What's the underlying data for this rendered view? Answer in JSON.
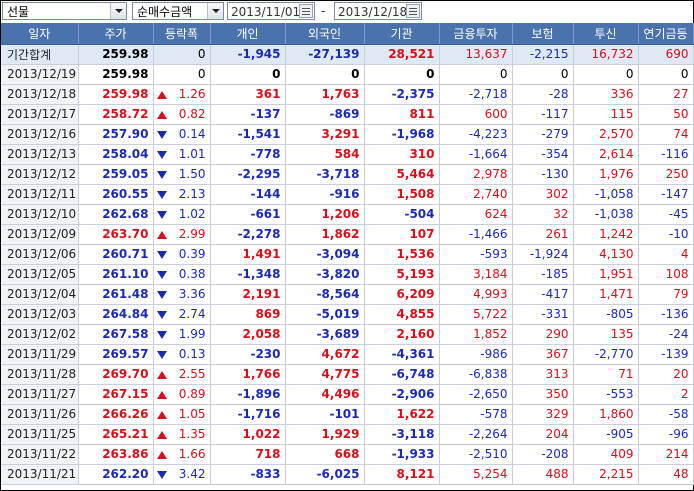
{
  "toolbar": {
    "market": "선물",
    "metric": "순매수금액",
    "date_from": "2013/11/01",
    "date_to": "2013/12/18",
    "separator": "-"
  },
  "colors": {
    "up": "#d4101a",
    "down": "#1a2bb0",
    "header": "#4a73ad"
  },
  "columns": [
    "일자",
    "주가",
    "등락폭",
    "개인",
    "외국인",
    "기관",
    "금융투자",
    "보험",
    "투신",
    "연기금등"
  ],
  "rows": [
    {
      "date": "기간합계",
      "price": "259.98",
      "dir": "",
      "chg": "0",
      "indiv": "-1,945",
      "foreign": "-27,139",
      "inst": "28,521",
      "fin": "13,637",
      "ins": "-2,215",
      "trust": "16,732",
      "pension": "690",
      "sum": true
    },
    {
      "date": "2013/12/19",
      "price": "259.98",
      "dir": "",
      "chg": "0",
      "indiv": "0",
      "foreign": "0",
      "inst": "0",
      "fin": "0",
      "ins": "0",
      "trust": "0",
      "pension": "0"
    },
    {
      "date": "2013/12/18",
      "price": "259.98",
      "dir": "up",
      "chg": "1.26",
      "indiv": "361",
      "foreign": "1,763",
      "inst": "-2,375",
      "fin": "-2,718",
      "ins": "-28",
      "trust": "336",
      "pension": "27"
    },
    {
      "date": "2013/12/17",
      "price": "258.72",
      "dir": "up",
      "chg": "0.82",
      "indiv": "-137",
      "foreign": "-869",
      "inst": "811",
      "fin": "600",
      "ins": "-117",
      "trust": "115",
      "pension": "50"
    },
    {
      "date": "2013/12/16",
      "price": "257.90",
      "dir": "dn",
      "chg": "0.14",
      "indiv": "-1,541",
      "foreign": "3,291",
      "inst": "-1,968",
      "fin": "-4,223",
      "ins": "-279",
      "trust": "2,570",
      "pension": "74"
    },
    {
      "date": "2013/12/13",
      "price": "258.04",
      "dir": "dn",
      "chg": "1.01",
      "indiv": "-778",
      "foreign": "584",
      "inst": "310",
      "fin": "-1,664",
      "ins": "-354",
      "trust": "2,614",
      "pension": "-116"
    },
    {
      "date": "2013/12/12",
      "price": "259.05",
      "dir": "dn",
      "chg": "1.50",
      "indiv": "-2,295",
      "foreign": "-3,718",
      "inst": "5,464",
      "fin": "2,978",
      "ins": "-130",
      "trust": "1,976",
      "pension": "250"
    },
    {
      "date": "2013/12/11",
      "price": "260.55",
      "dir": "dn",
      "chg": "2.13",
      "indiv": "-144",
      "foreign": "-916",
      "inst": "1,508",
      "fin": "2,740",
      "ins": "302",
      "trust": "-1,058",
      "pension": "-147"
    },
    {
      "date": "2013/12/10",
      "price": "262.68",
      "dir": "dn",
      "chg": "1.02",
      "indiv": "-661",
      "foreign": "1,206",
      "inst": "-504",
      "fin": "624",
      "ins": "32",
      "trust": "-1,038",
      "pension": "-45"
    },
    {
      "date": "2013/12/09",
      "price": "263.70",
      "dir": "up",
      "chg": "2.99",
      "indiv": "-2,278",
      "foreign": "1,862",
      "inst": "107",
      "fin": "-1,466",
      "ins": "261",
      "trust": "1,242",
      "pension": "-10"
    },
    {
      "date": "2013/12/06",
      "price": "260.71",
      "dir": "dn",
      "chg": "0.39",
      "indiv": "1,491",
      "foreign": "-3,094",
      "inst": "1,536",
      "fin": "-593",
      "ins": "-1,924",
      "trust": "4,130",
      "pension": "4"
    },
    {
      "date": "2013/12/05",
      "price": "261.10",
      "dir": "dn",
      "chg": "0.38",
      "indiv": "-1,348",
      "foreign": "-3,820",
      "inst": "5,193",
      "fin": "3,184",
      "ins": "-185",
      "trust": "1,951",
      "pension": "108"
    },
    {
      "date": "2013/12/04",
      "price": "261.48",
      "dir": "dn",
      "chg": "3.36",
      "indiv": "2,191",
      "foreign": "-8,564",
      "inst": "6,209",
      "fin": "4,993",
      "ins": "-417",
      "trust": "1,471",
      "pension": "79"
    },
    {
      "date": "2013/12/03",
      "price": "264.84",
      "dir": "dn",
      "chg": "2.74",
      "indiv": "869",
      "foreign": "-5,019",
      "inst": "4,855",
      "fin": "5,722",
      "ins": "-331",
      "trust": "-805",
      "pension": "-136"
    },
    {
      "date": "2013/12/02",
      "price": "267.58",
      "dir": "dn",
      "chg": "1.99",
      "indiv": "2,058",
      "foreign": "-3,689",
      "inst": "2,160",
      "fin": "1,852",
      "ins": "290",
      "trust": "135",
      "pension": "-24"
    },
    {
      "date": "2013/11/29",
      "price": "269.57",
      "dir": "dn",
      "chg": "0.13",
      "indiv": "-230",
      "foreign": "4,672",
      "inst": "-4,361",
      "fin": "-986",
      "ins": "367",
      "trust": "-2,770",
      "pension": "-139"
    },
    {
      "date": "2013/11/28",
      "price": "269.70",
      "dir": "up",
      "chg": "2.55",
      "indiv": "1,766",
      "foreign": "4,775",
      "inst": "-6,748",
      "fin": "-6,838",
      "ins": "313",
      "trust": "71",
      "pension": "20"
    },
    {
      "date": "2013/11/27",
      "price": "267.15",
      "dir": "up",
      "chg": "0.89",
      "indiv": "-1,896",
      "foreign": "4,496",
      "inst": "-2,906",
      "fin": "-2,650",
      "ins": "350",
      "trust": "-553",
      "pension": "2"
    },
    {
      "date": "2013/11/26",
      "price": "266.26",
      "dir": "up",
      "chg": "1.05",
      "indiv": "-1,716",
      "foreign": "-101",
      "inst": "1,622",
      "fin": "-578",
      "ins": "329",
      "trust": "1,860",
      "pension": "-58"
    },
    {
      "date": "2013/11/25",
      "price": "265.21",
      "dir": "up",
      "chg": "1.35",
      "indiv": "1,022",
      "foreign": "1,929",
      "inst": "-3,118",
      "fin": "-2,264",
      "ins": "204",
      "trust": "-905",
      "pension": "-96"
    },
    {
      "date": "2013/11/22",
      "price": "263.86",
      "dir": "up",
      "chg": "1.66",
      "indiv": "718",
      "foreign": "668",
      "inst": "-1,933",
      "fin": "-2,510",
      "ins": "-208",
      "trust": "409",
      "pension": "214"
    },
    {
      "date": "2013/11/21",
      "price": "262.20",
      "dir": "dn",
      "chg": "3.42",
      "indiv": "-833",
      "foreign": "-6,025",
      "inst": "8,121",
      "fin": "5,254",
      "ins": "488",
      "trust": "2,215",
      "pension": "48"
    }
  ]
}
